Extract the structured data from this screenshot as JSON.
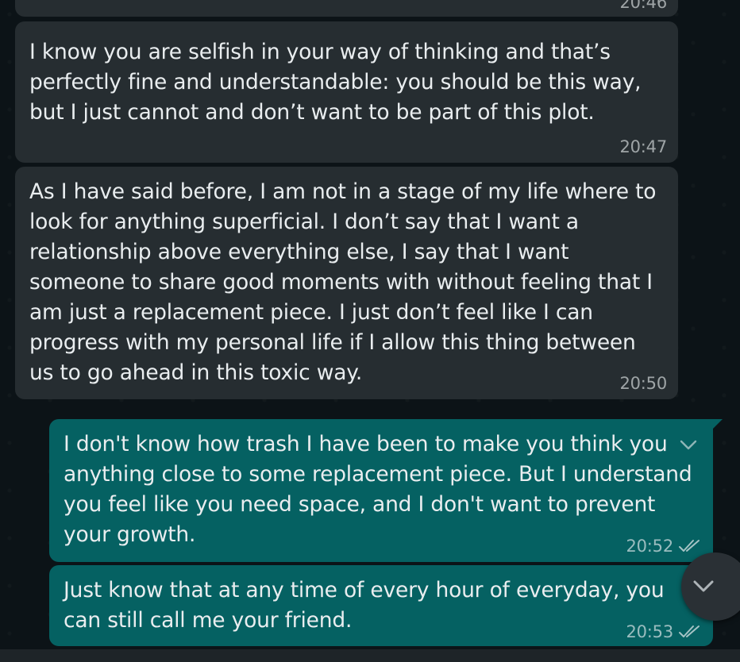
{
  "messages": [
    {
      "direction": "in",
      "text": "",
      "time": "20:46"
    },
    {
      "direction": "in",
      "text": "I know you are selfish in your way of thinking and that’s perfectly fine and understandable: you should be this way, but I just cannot and don’t want to be part of this plot.",
      "time": "20:47"
    },
    {
      "direction": "in",
      "text": "As I have said before, I am not in a stage of my life where to look for anything superficial. I don’t say that I want a relationship above everything else, I say that I want someone to share good moments with without feeling that I am just a replacement piece. I just don’t feel like I can progress with my personal life if I allow this thing between us to go ahead in this toxic way.",
      "time": "20:50"
    },
    {
      "direction": "out",
      "text": "I don't know how trash I have been to make you think you anything close to some replacement piece. But I understand you feel like you need space, and I don't want to prevent your growth.",
      "time": "20:52",
      "status": "read"
    },
    {
      "direction": "out",
      "text": "Just know that at any time of every hour of everyday, you can still call me your friend.",
      "time": "20:53",
      "status": "read"
    }
  ],
  "icons": {
    "read_receipt": "double-check-icon",
    "message_menu": "chevron-down-icon",
    "scroll_down": "chevron-down-icon"
  },
  "colors": {
    "background": "#0c1317",
    "incoming_bubble": "#262d31",
    "outgoing_bubble": "#056162",
    "text": "#e9edef",
    "meta_text": "#8d9599"
  }
}
